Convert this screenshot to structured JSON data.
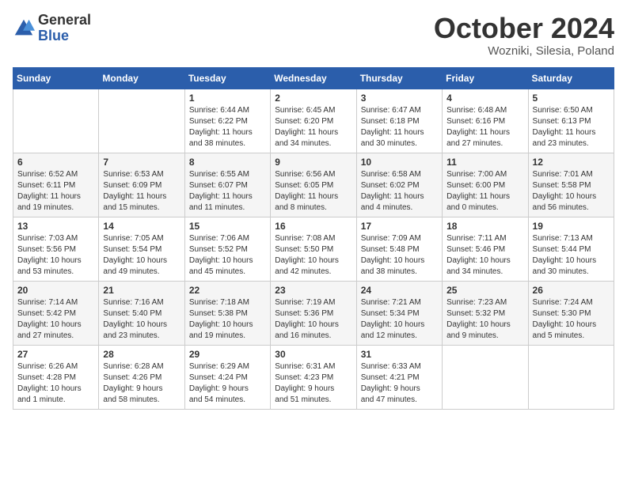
{
  "logo": {
    "general": "General",
    "blue": "Blue"
  },
  "title": {
    "month_year": "October 2024",
    "location": "Wozniki, Silesia, Poland"
  },
  "weekdays": [
    "Sunday",
    "Monday",
    "Tuesday",
    "Wednesday",
    "Thursday",
    "Friday",
    "Saturday"
  ],
  "weeks": [
    [
      {
        "day": "",
        "info": ""
      },
      {
        "day": "",
        "info": ""
      },
      {
        "day": "1",
        "info": "Sunrise: 6:44 AM\nSunset: 6:22 PM\nDaylight: 11 hours\nand 38 minutes."
      },
      {
        "day": "2",
        "info": "Sunrise: 6:45 AM\nSunset: 6:20 PM\nDaylight: 11 hours\nand 34 minutes."
      },
      {
        "day": "3",
        "info": "Sunrise: 6:47 AM\nSunset: 6:18 PM\nDaylight: 11 hours\nand 30 minutes."
      },
      {
        "day": "4",
        "info": "Sunrise: 6:48 AM\nSunset: 6:16 PM\nDaylight: 11 hours\nand 27 minutes."
      },
      {
        "day": "5",
        "info": "Sunrise: 6:50 AM\nSunset: 6:13 PM\nDaylight: 11 hours\nand 23 minutes."
      }
    ],
    [
      {
        "day": "6",
        "info": "Sunrise: 6:52 AM\nSunset: 6:11 PM\nDaylight: 11 hours\nand 19 minutes."
      },
      {
        "day": "7",
        "info": "Sunrise: 6:53 AM\nSunset: 6:09 PM\nDaylight: 11 hours\nand 15 minutes."
      },
      {
        "day": "8",
        "info": "Sunrise: 6:55 AM\nSunset: 6:07 PM\nDaylight: 11 hours\nand 11 minutes."
      },
      {
        "day": "9",
        "info": "Sunrise: 6:56 AM\nSunset: 6:05 PM\nDaylight: 11 hours\nand 8 minutes."
      },
      {
        "day": "10",
        "info": "Sunrise: 6:58 AM\nSunset: 6:02 PM\nDaylight: 11 hours\nand 4 minutes."
      },
      {
        "day": "11",
        "info": "Sunrise: 7:00 AM\nSunset: 6:00 PM\nDaylight: 11 hours\nand 0 minutes."
      },
      {
        "day": "12",
        "info": "Sunrise: 7:01 AM\nSunset: 5:58 PM\nDaylight: 10 hours\nand 56 minutes."
      }
    ],
    [
      {
        "day": "13",
        "info": "Sunrise: 7:03 AM\nSunset: 5:56 PM\nDaylight: 10 hours\nand 53 minutes."
      },
      {
        "day": "14",
        "info": "Sunrise: 7:05 AM\nSunset: 5:54 PM\nDaylight: 10 hours\nand 49 minutes."
      },
      {
        "day": "15",
        "info": "Sunrise: 7:06 AM\nSunset: 5:52 PM\nDaylight: 10 hours\nand 45 minutes."
      },
      {
        "day": "16",
        "info": "Sunrise: 7:08 AM\nSunset: 5:50 PM\nDaylight: 10 hours\nand 42 minutes."
      },
      {
        "day": "17",
        "info": "Sunrise: 7:09 AM\nSunset: 5:48 PM\nDaylight: 10 hours\nand 38 minutes."
      },
      {
        "day": "18",
        "info": "Sunrise: 7:11 AM\nSunset: 5:46 PM\nDaylight: 10 hours\nand 34 minutes."
      },
      {
        "day": "19",
        "info": "Sunrise: 7:13 AM\nSunset: 5:44 PM\nDaylight: 10 hours\nand 30 minutes."
      }
    ],
    [
      {
        "day": "20",
        "info": "Sunrise: 7:14 AM\nSunset: 5:42 PM\nDaylight: 10 hours\nand 27 minutes."
      },
      {
        "day": "21",
        "info": "Sunrise: 7:16 AM\nSunset: 5:40 PM\nDaylight: 10 hours\nand 23 minutes."
      },
      {
        "day": "22",
        "info": "Sunrise: 7:18 AM\nSunset: 5:38 PM\nDaylight: 10 hours\nand 19 minutes."
      },
      {
        "day": "23",
        "info": "Sunrise: 7:19 AM\nSunset: 5:36 PM\nDaylight: 10 hours\nand 16 minutes."
      },
      {
        "day": "24",
        "info": "Sunrise: 7:21 AM\nSunset: 5:34 PM\nDaylight: 10 hours\nand 12 minutes."
      },
      {
        "day": "25",
        "info": "Sunrise: 7:23 AM\nSunset: 5:32 PM\nDaylight: 10 hours\nand 9 minutes."
      },
      {
        "day": "26",
        "info": "Sunrise: 7:24 AM\nSunset: 5:30 PM\nDaylight: 10 hours\nand 5 minutes."
      }
    ],
    [
      {
        "day": "27",
        "info": "Sunrise: 6:26 AM\nSunset: 4:28 PM\nDaylight: 10 hours\nand 1 minute."
      },
      {
        "day": "28",
        "info": "Sunrise: 6:28 AM\nSunset: 4:26 PM\nDaylight: 9 hours\nand 58 minutes."
      },
      {
        "day": "29",
        "info": "Sunrise: 6:29 AM\nSunset: 4:24 PM\nDaylight: 9 hours\nand 54 minutes."
      },
      {
        "day": "30",
        "info": "Sunrise: 6:31 AM\nSunset: 4:23 PM\nDaylight: 9 hours\nand 51 minutes."
      },
      {
        "day": "31",
        "info": "Sunrise: 6:33 AM\nSunset: 4:21 PM\nDaylight: 9 hours\nand 47 minutes."
      },
      {
        "day": "",
        "info": ""
      },
      {
        "day": "",
        "info": ""
      }
    ]
  ]
}
